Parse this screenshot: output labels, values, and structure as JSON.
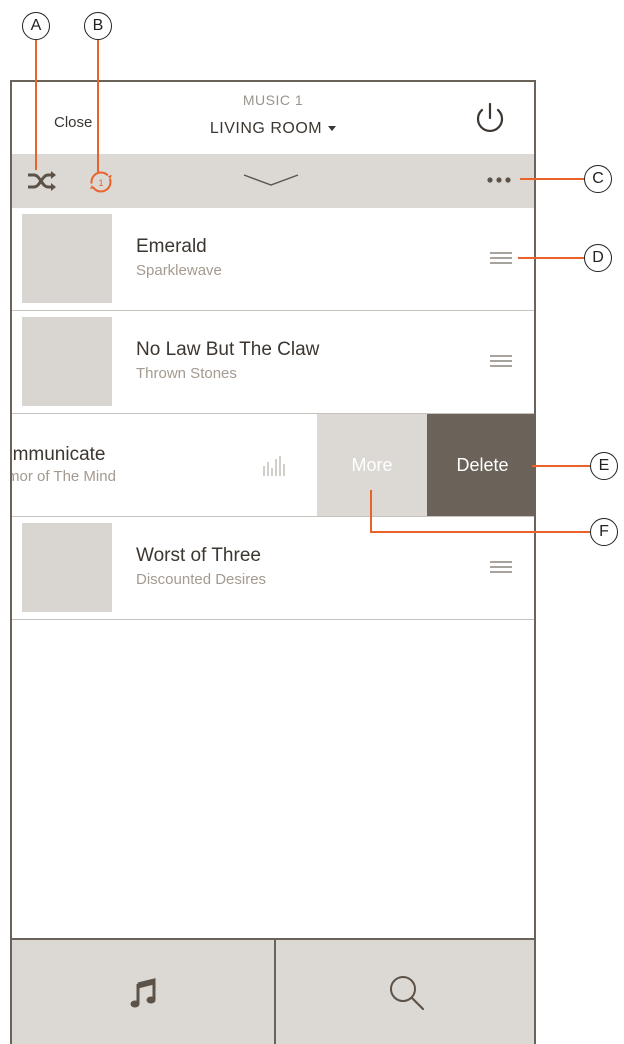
{
  "header": {
    "close_label": "Close",
    "zone_title": "MUSIC 1",
    "zone_name": "LIVING ROOM"
  },
  "toolbar": {
    "shuffle_icon": "shuffle-icon",
    "repeat_icon": "repeat-one-icon",
    "repeat_badge": "1",
    "collapse_icon": "chevron-down-icon",
    "more_icon": "ellipsis-icon",
    "active_color": "#e8622a"
  },
  "queue": [
    {
      "song": "Emerald",
      "artist": "Sparklewave"
    },
    {
      "song": "No Law But The Claw",
      "artist": "Thrown Stones"
    },
    {
      "song": "ommunicate",
      "artist": "rmor of The Mind",
      "swiped": true
    },
    {
      "song": "Worst of Three",
      "artist": "Discounted Desires"
    }
  ],
  "swipe_actions": {
    "more_label": "More",
    "delete_label": "Delete"
  },
  "bottom_nav": {
    "music_icon": "music-note-icon",
    "search_icon": "search-icon"
  },
  "callouts": [
    "A",
    "B",
    "C",
    "D",
    "E",
    "F"
  ],
  "colors": {
    "accent": "#e8622a",
    "toolbar_bg": "#dcd8d3",
    "delete_bg": "#6b625a"
  }
}
